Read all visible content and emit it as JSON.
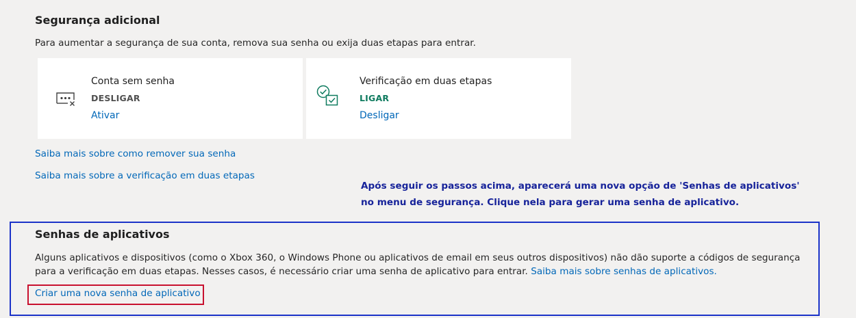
{
  "additional_security": {
    "title": "Segurança adicional",
    "description": "Para aumentar a segurança de sua conta, remova sua senha ou exija duas etapas para entrar.",
    "cards": [
      {
        "icon": "password-dots-icon",
        "title": "Conta sem senha",
        "status": "DESLIGAR",
        "status_color": "#505050",
        "action": "Ativar"
      },
      {
        "icon": "two-step-check-icon",
        "title": "Verificação em duas etapas",
        "status": "LIGAR",
        "status_color": "#0f7b5f",
        "action": "Desligar"
      }
    ],
    "learn_links": [
      "Saiba mais sobre como remover sua senha",
      "Saiba mais sobre a verificação em duas etapas"
    ]
  },
  "annotation": {
    "line1": "Após seguir os passos acima, aparecerá uma nova opção de 'Senhas de aplicativos'",
    "line2": "no menu de segurança. Clique nela para gerar uma senha de aplicativo.",
    "color": "#17239a"
  },
  "app_passwords": {
    "title": "Senhas de aplicativos",
    "description": "Alguns aplicativos e dispositivos (como o Xbox 360, o Windows Phone ou aplicativos de email em seus outros dispositivos) não dão suporte a códigos de segurança para a verificação em duas etapas. Nesses casos, é necessário criar uma senha de aplicativo para entrar.",
    "learn_link": "Saiba mais sobre senhas de aplicativos.",
    "create_link": "Criar uma nova senha de aplicativo",
    "highlight_color": "#1a32c8",
    "create_highlight_color": "#c8102e"
  },
  "link_color": "#0067b8"
}
